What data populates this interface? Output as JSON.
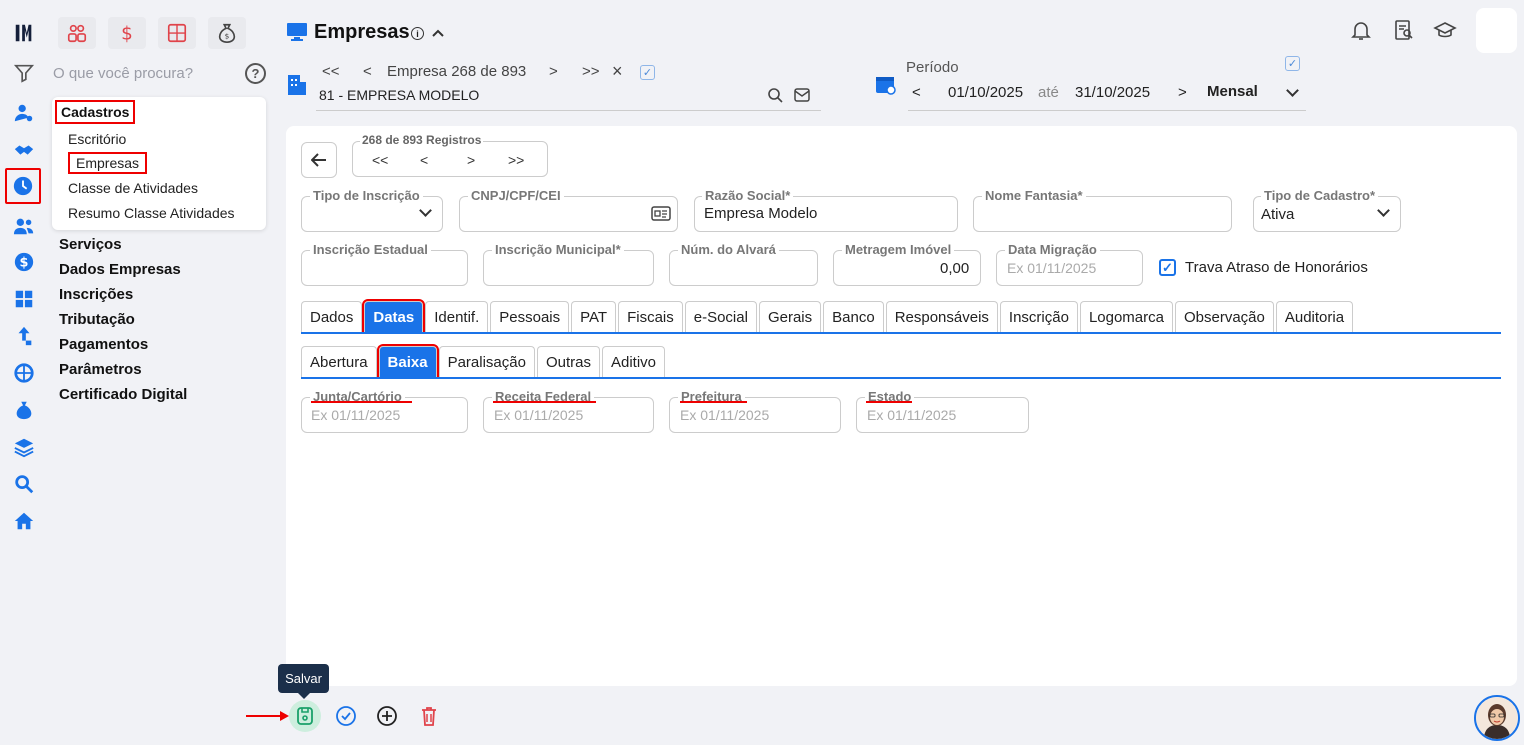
{
  "colors": {
    "accent": "#1a73e8",
    "highlight": "#e00000",
    "tooltip_bg": "#1b2f4a"
  },
  "search": {
    "placeholder": "O que você procura?"
  },
  "menu": {
    "section_title": "Cadastros",
    "sub_items": [
      "Escritório",
      "Empresas",
      "Classe de Atividades",
      "Resumo Classe Atividades"
    ],
    "main_items": [
      "Serviços",
      "Dados Empresas",
      "Inscrições",
      "Tributação",
      "Pagamentos",
      "Parâmetros",
      "Certificado Digital"
    ]
  },
  "header": {
    "title": "Empresas",
    "info": "i"
  },
  "company_nav": {
    "first": "<<",
    "prev": "<",
    "label": "Empresa 268 de 893",
    "next": ">",
    "last": ">>",
    "close": "×",
    "company": "81 - EMPRESA MODELO"
  },
  "period": {
    "label": "Período",
    "prev": "<",
    "start": "01/10/2025",
    "until": "até",
    "end": "31/10/2025",
    "next": ">",
    "mode": "Mensal"
  },
  "records": {
    "label": "268 de 893 Registros",
    "first": "<<",
    "prev": "<",
    "next": ">",
    "last": ">>"
  },
  "form": {
    "tipo_inscricao": {
      "label": "Tipo de Inscrição",
      "value": ""
    },
    "cnpj": {
      "label": "CNPJ/CPF/CEI",
      "value": ""
    },
    "razao_social": {
      "label": "Razão Social*",
      "value": "Empresa Modelo"
    },
    "nome_fantasia": {
      "label": "Nome Fantasia*",
      "value": ""
    },
    "tipo_cadastro": {
      "label": "Tipo de Cadastro*",
      "value": "Ativa"
    },
    "inscricao_estadual": {
      "label": "Inscrição Estadual",
      "value": ""
    },
    "inscricao_municipal": {
      "label": "Inscrição Municipal*",
      "value": ""
    },
    "num_alvara": {
      "label": "Núm. do Alvará",
      "value": ""
    },
    "metragem": {
      "label": "Metragem Imóvel",
      "value": "0,00"
    },
    "data_migracao": {
      "label": "Data Migração",
      "placeholder": "Ex 01/11/2025"
    },
    "trava": {
      "label": "Trava Atraso de Honorários",
      "checked": true
    }
  },
  "tabs": [
    "Dados",
    "Datas",
    "Identif.",
    "Pessoais",
    "PAT",
    "Fiscais",
    "e-Social",
    "Gerais",
    "Banco",
    "Responsáveis",
    "Inscrição",
    "Logomarca",
    "Observação",
    "Auditoria"
  ],
  "active_tab": "Datas",
  "subtabs": [
    "Abertura",
    "Baixa",
    "Paralisação",
    "Outras",
    "Aditivo"
  ],
  "active_subtab": "Baixa",
  "baixa_fields": [
    {
      "label": "Junta/Cartório",
      "placeholder": "Ex 01/11/2025"
    },
    {
      "label": "Receita Federal",
      "placeholder": "Ex 01/11/2025"
    },
    {
      "label": "Prefeitura",
      "placeholder": "Ex 01/11/2025"
    },
    {
      "label": "Estado",
      "placeholder": "Ex 01/11/2025"
    }
  ],
  "toolbar": {
    "save_tooltip": "Salvar"
  }
}
